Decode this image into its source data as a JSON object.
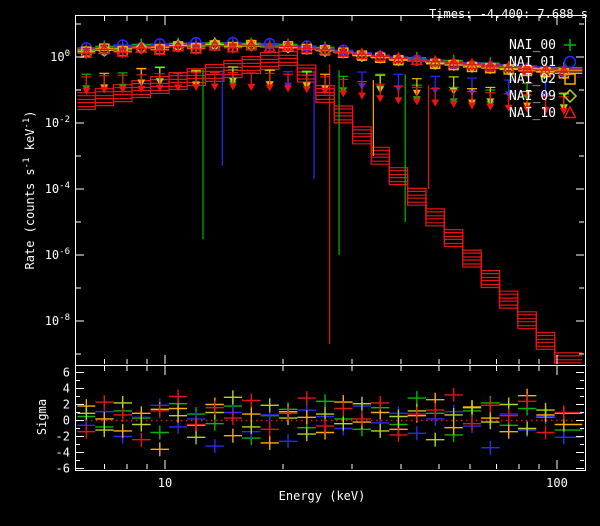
{
  "header": {
    "times_label": "Times: -4.400: 7.688 s"
  },
  "colors": {
    "background": "#000000",
    "frame": "#ffffff",
    "text": "#ffffff",
    "model_red": "#e81414",
    "zero_line_red": "#e81414"
  },
  "axes": {
    "x": {
      "label": "Energy (keV)",
      "scale": "log",
      "range_kev": [
        5.9,
        116
      ],
      "major_ticks": [
        10,
        100
      ],
      "major_tick_labels": [
        "10",
        "100"
      ],
      "minor_ticks": [
        7,
        8,
        9,
        20,
        30,
        40,
        50,
        60,
        70,
        80,
        90
      ]
    },
    "y_main": {
      "label_parts": [
        "Rate (counts s",
        "-1",
        " keV",
        "-1",
        ")"
      ],
      "scale": "log",
      "labeled_decades": [
        0,
        -2,
        -4,
        -6,
        -8
      ],
      "tick_decades": [
        1,
        0,
        -1,
        -2,
        -3,
        -4,
        -5,
        -6,
        -7,
        -8,
        -9
      ]
    },
    "y_sigma": {
      "label": "Sigma",
      "labeled_ticks": [
        6,
        4,
        2,
        0,
        -2,
        -4,
        -6
      ],
      "minor_ticks": [
        5,
        3,
        1,
        -1,
        -3,
        -5
      ],
      "range": [
        -7,
        7
      ],
      "zero_line": 0
    }
  },
  "legend": [
    {
      "label": "NAI_00",
      "marker": "plus",
      "color": "#00b800"
    },
    {
      "label": "NAI_01",
      "marker": "circle",
      "color": "#2a2aff"
    },
    {
      "label": "NAI_02",
      "marker": "square",
      "color": "#ffaa00"
    },
    {
      "label": "NAI_09",
      "marker": "diamond",
      "color": "#b4d41e"
    },
    {
      "label": "NAI_10",
      "marker": "triangle",
      "color": "#e81414"
    }
  ],
  "chart_data": {
    "type": "scatter",
    "title": "",
    "xlabel": "Energy (keV)",
    "ylabel_main": "Rate (counts s-1 keV-1)",
    "ylabel_bottom": "Sigma",
    "x_energies": [
      6.3,
      7.0,
      7.8,
      8.7,
      9.7,
      10.8,
      12.0,
      13.4,
      14.9,
      16.6,
      18.5,
      20.6,
      23.0,
      25.6,
      28.5,
      31.8,
      35.4,
      39.4,
      43.9,
      48.9,
      54.5,
      60.7,
      67.6,
      75.3,
      83.9,
      93.5,
      104.1
    ],
    "last_bin_edge": 116,
    "total_model": [
      1.8,
      1.9,
      2.0,
      2.1,
      2.2,
      2.3,
      2.38,
      2.42,
      2.42,
      2.38,
      2.3,
      2.18,
      2.0,
      1.78,
      1.52,
      1.28,
      1.08,
      0.95,
      0.85,
      0.77,
      0.7,
      0.64,
      0.59,
      0.55,
      0.51,
      0.47,
      0.44
    ],
    "source_model": {
      "color": "#e81414",
      "e_peak_kev": 21.0,
      "rate_peak": 1.9,
      "rise_index": 2.6,
      "fall_index": -13.3,
      "copies": [
        1.0,
        0.62,
        0.38
      ]
    },
    "series": [
      {
        "name": "NAI_00",
        "color": "#00b800",
        "marker": "plus",
        "model_scale": 1.0,
        "rates": [
          1.55,
          2.1,
          1.7,
          2.4,
          null,
          2.6,
          2.2,
          2.7,
          2.2,
          2.6,
          2.1,
          2.4,
          1.8,
          1.95,
          1.4,
          1.15,
          null,
          0.85,
          0.95,
          0.7,
          0.78,
          0.58,
          0.65,
          0.5,
          null,
          0.43,
          0.48
        ],
        "limits": [
          0.3,
          null,
          0.33,
          null,
          0.5,
          null,
          0.4,
          null,
          0.41,
          null,
          0.39,
          null,
          0.34,
          null,
          0.26,
          null,
          0.3,
          null,
          0.14,
          null,
          0.12,
          null,
          0.1,
          null,
          0.16,
          null,
          0.075
        ],
        "sigma": [
          0.5,
          -0.8,
          1.2,
          0.3,
          -1.5,
          2.1,
          0.8,
          -0.4,
          1.8,
          -2.2,
          0.6,
          1.4,
          -0.9,
          2.4,
          0.2,
          -1.1,
          1.6,
          -0.5,
          2.8,
          0.9,
          -1.8,
          1.2,
          2.2,
          -0.6,
          1.5,
          0.4,
          -1.2
        ]
      },
      {
        "name": "NAI_01",
        "color": "#2a2aff",
        "marker": "circle",
        "model_scale": 1.06,
        "rates": [
          1.9,
          1.6,
          2.3,
          1.9,
          2.5,
          2.1,
          2.7,
          2.3,
          2.75,
          2.3,
          2.55,
          2.05,
          2.15,
          1.7,
          1.6,
          null,
          1.05,
          null,
          0.8,
          null,
          0.6,
          null,
          0.5,
          null,
          0.42,
          null,
          0.36
        ],
        "limits": [
          null,
          null,
          null,
          0.42,
          null,
          null,
          null,
          null,
          null,
          null,
          null,
          0.36,
          null,
          null,
          null,
          0.35,
          null,
          0.3,
          null,
          0.26,
          null,
          0.23,
          null,
          0.2,
          null,
          0.18,
          null
        ],
        "sigma": [
          -0.6,
          1.1,
          -2.0,
          0.4,
          1.9,
          -0.8,
          0.2,
          -3.2,
          1.0,
          -1.4,
          0.7,
          -2.6,
          1.3,
          0.5,
          -1.0,
          1.8,
          -0.3,
          0.9,
          -1.6,
          0.2,
          1.1,
          -0.7,
          -3.4,
          0.8,
          -1.2,
          0.5,
          -2.1
        ]
      },
      {
        "name": "NAI_02",
        "color": "#ffaa00",
        "marker": "square",
        "model_scale": 0.9,
        "rates": [
          1.45,
          1.8,
          1.5,
          null,
          1.7,
          2.1,
          1.85,
          2.25,
          2.0,
          2.3,
          null,
          2.1,
          1.75,
          1.6,
          1.35,
          1.1,
          0.95,
          0.8,
          null,
          0.62,
          0.57,
          0.5,
          0.46,
          0.42,
          0.38,
          0.35,
          0.32
        ],
        "limits": [
          null,
          0.32,
          null,
          0.45,
          null,
          null,
          0.38,
          null,
          null,
          null,
          0.4,
          null,
          null,
          0.3,
          null,
          null,
          null,
          null,
          0.22,
          null,
          null,
          0.11,
          null,
          null,
          0.09,
          null,
          null
        ],
        "sigma": [
          1.8,
          0.2,
          -1.3,
          0.9,
          -3.6,
          1.5,
          -0.6,
          2.0,
          -1.9,
          0.8,
          -2.8,
          1.1,
          0.4,
          -1.5,
          2.3,
          -0.2,
          1.0,
          -1.1,
          0.6,
          2.6,
          -0.9,
          1.7,
          0.3,
          -1.4,
          3.1,
          0.7,
          -0.5
        ]
      },
      {
        "name": "NAI_09",
        "color": "#b4d41e",
        "marker": "diamond",
        "model_scale": 0.95,
        "rates": [
          null,
          1.6,
          null,
          1.9,
          null,
          2.2,
          null,
          2.4,
          null,
          2.3,
          null,
          2.0,
          null,
          1.55,
          null,
          1.1,
          null,
          0.85,
          null,
          0.65,
          null,
          0.55,
          null,
          0.45,
          null,
          0.37,
          null
        ],
        "limits": [
          null,
          null,
          null,
          null,
          0.48,
          null,
          null,
          null,
          0.5,
          null,
          null,
          null,
          0.37,
          null,
          null,
          null,
          0.28,
          null,
          null,
          null,
          0.25,
          null,
          0.12,
          null,
          null,
          null,
          0.08
        ],
        "sigma": [
          0.9,
          -1.2,
          2.2,
          -0.5,
          1.4,
          0.6,
          -2.1,
          1.0,
          2.9,
          -0.8,
          1.9,
          0.3,
          -1.7,
          0.8,
          -0.4,
          2.1,
          -1.3,
          0.5,
          1.2,
          -2.4,
          0.7,
          1.6,
          -0.2,
          2.0,
          -1.0,
          1.3,
          0.9
        ]
      },
      {
        "name": "NAI_10",
        "color": "#e81414",
        "marker": "triangle",
        "model_scale": 0.97,
        "rates": [
          1.3,
          1.7,
          1.4,
          1.85,
          1.6,
          2.05,
          1.75,
          2.2,
          1.9,
          2.25,
          1.95,
          2.1,
          1.8,
          1.65,
          1.4,
          1.2,
          1.05,
          0.9,
          0.8,
          0.72,
          0.65,
          0.58,
          0.53,
          0.48,
          0.44,
          0.4,
          0.37
        ],
        "limits": [
          0.25,
          0.27,
          0.28,
          0.29,
          0.31,
          0.32,
          0.33,
          0.34,
          0.34,
          0.33,
          0.32,
          0.3,
          0.28,
          0.25,
          0.21,
          0.18,
          0.15,
          0.13,
          0.12,
          0.11,
          0.1,
          0.09,
          0.083,
          0.077,
          0.071,
          0.066,
          0.062
        ],
        "sigma": [
          -1.4,
          2.3,
          0.7,
          -2.4,
          1.2,
          3.0,
          -0.5,
          1.6,
          0.3,
          2.5,
          -1.1,
          0.9,
          2.8,
          -0.7,
          1.5,
          0.2,
          2.2,
          -1.8,
          0.8,
          1.3,
          3.2,
          -0.4,
          1.9,
          0.6,
          2.4,
          -1.5,
          1.0
        ]
      }
    ],
    "spikes": [
      {
        "color": "#00b800",
        "e": 12.5,
        "r1": 0.45,
        "r2": 3e-06
      },
      {
        "color": "#e81414",
        "e": 26.3,
        "r1": 0.6,
        "r2": 2e-09
      },
      {
        "color": "#2a2aff",
        "e": 24.0,
        "r1": 0.35,
        "r2": 0.0002
      },
      {
        "color": "#00b800",
        "e": 27.8,
        "r1": 0.4,
        "r2": 1e-06
      },
      {
        "color": "#00b800",
        "e": 41.0,
        "r1": 0.3,
        "r2": 1e-05
      },
      {
        "color": "#e81414",
        "e": 47.0,
        "r1": 0.14,
        "r2": 0.0001
      },
      {
        "color": "#ffaa00",
        "e": 34.0,
        "r1": 0.2,
        "r2": 0.001
      },
      {
        "color": "#2a2aff",
        "e": 14.0,
        "r1": 0.4,
        "r2": 0.0005
      }
    ]
  }
}
